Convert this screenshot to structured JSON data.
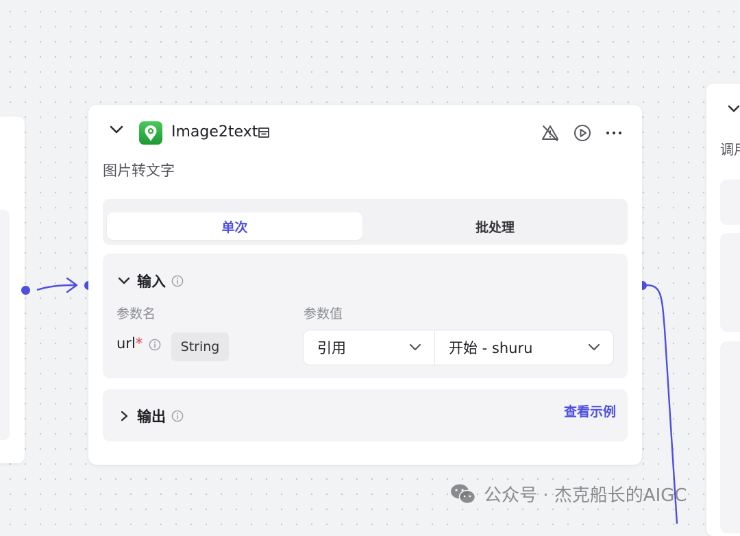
{
  "node": {
    "title": "Image2text",
    "subtitle": "图片转文字",
    "tabs": [
      {
        "label": "单次",
        "active": true
      },
      {
        "label": "批处理",
        "active": false
      }
    ],
    "input": {
      "title": "输入",
      "col_name": "参数名",
      "col_value": "参数值",
      "param": {
        "name": "url",
        "required_mark": "*",
        "type": "String",
        "source": "引用",
        "value": "开始 - shuru"
      }
    },
    "output": {
      "title": "输出",
      "example_link": "查看示例"
    }
  },
  "right_node": {
    "partial_text": "调用"
  },
  "watermark": {
    "text": "公众号 · 杰克船长的AIGC"
  },
  "icons": {
    "collapse": "chevron-down-icon",
    "app": "map-pin-app-icon",
    "store": "store-icon",
    "no-error": "alert-off-icon",
    "run": "play-circle-icon",
    "more": "more-icon",
    "info": "info-icon",
    "expand": "chevron-right-icon"
  },
  "colors": {
    "accent": "#4e4ee0",
    "required": "#e04848",
    "app_icon": "#2fb044"
  }
}
